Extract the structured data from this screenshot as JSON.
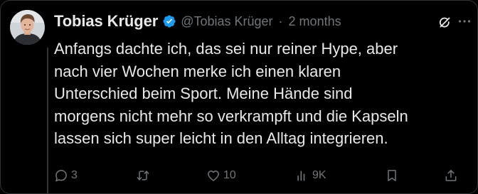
{
  "tweet": {
    "author": {
      "name": "Tobias Krüger",
      "handle": "@Tobias Krüger",
      "verified": true
    },
    "separator": "·",
    "timestamp": "2 months",
    "text": "Anfangs dachte ich, das sei nur reiner Hype, aber\nnach vier Wochen merke ich einen klaren\nUnterschied beim Sport. Meine Hände sind\nmorgens nicht mehr so verkrampft und die Kapseln\nlassen sich super leicht in den Alltag integrieren.",
    "actions": {
      "reply_count": "3",
      "retweet_count": "",
      "like_count": "10",
      "views_count": "9K"
    }
  },
  "colors": {
    "background": "#000000",
    "text_primary": "#e7e9ea",
    "text_secondary": "#71767b",
    "verified_blue": "#1d9bf0",
    "border": "#2f3336"
  },
  "icons": {
    "verified": "verified-badge-icon",
    "grok": "grok-icon",
    "more": "more-icon",
    "reply": "reply-icon",
    "retweet": "retweet-icon",
    "like": "heart-icon",
    "views": "views-icon",
    "bookmark": "bookmark-icon",
    "share": "share-icon"
  }
}
